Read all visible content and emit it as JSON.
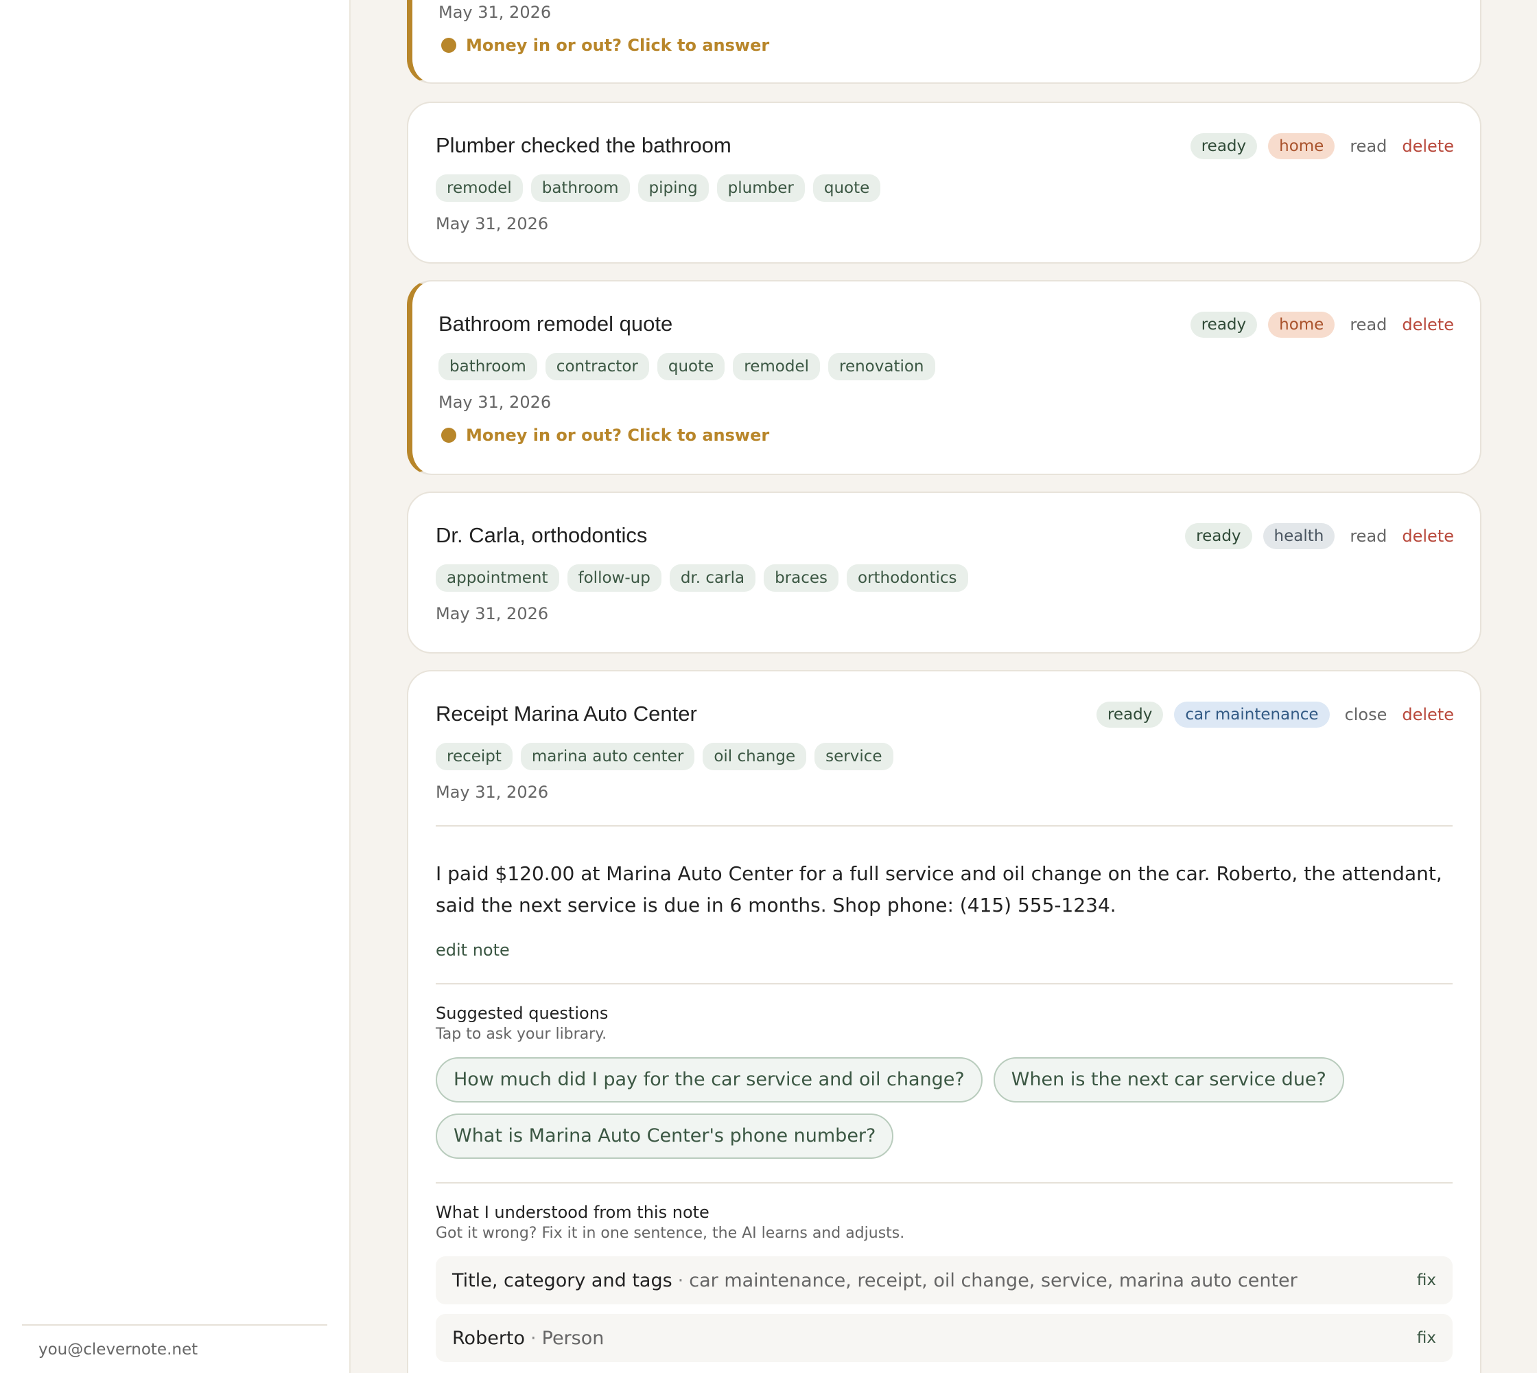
{
  "sidebar": {
    "user_email": "you@clevernote.net"
  },
  "cards": [
    {
      "date": "May 31, 2026",
      "prompt": "Money in or out? Click to answer"
    },
    {
      "title": "Plumber checked the bathroom",
      "status": "ready",
      "category": "home",
      "action": "read",
      "delete": "delete",
      "tags": [
        "remodel",
        "bathroom",
        "piping",
        "plumber",
        "quote"
      ],
      "date": "May 31, 2026"
    },
    {
      "title": "Bathroom remodel quote",
      "status": "ready",
      "category": "home",
      "action": "read",
      "delete": "delete",
      "tags": [
        "bathroom",
        "contractor",
        "quote",
        "remodel",
        "renovation"
      ],
      "date": "May 31, 2026",
      "prompt": "Money in or out? Click to answer"
    },
    {
      "title": "Dr. Carla, orthodontics",
      "status": "ready",
      "category": "health",
      "action": "read",
      "delete": "delete",
      "tags": [
        "appointment",
        "follow-up",
        "dr. carla",
        "braces",
        "orthodontics"
      ],
      "date": "May 31, 2026"
    },
    {
      "title": "Receipt Marina Auto Center",
      "status": "ready",
      "category": "car maintenance",
      "action": "close",
      "delete": "delete",
      "tags": [
        "receipt",
        "marina auto center",
        "oil change",
        "service"
      ],
      "date": "May 31, 2026",
      "body": "I paid $120.00 at Marina Auto Center for a full service and oil change on the car. Roberto, the attendant, said the next service is due in 6 months. Shop phone: (415) 555-1234.",
      "edit_label": "edit note",
      "suggested": {
        "title": "Suggested questions",
        "subtitle": "Tap to ask your library.",
        "questions": [
          "How much did I pay for the car service and oil change?",
          "When is the next car service due?",
          "What is Marina Auto Center's phone number?"
        ]
      },
      "understood": {
        "title": "What I understood from this note",
        "subtitle": "Got it wrong? Fix it in one sentence, the AI learns and adjusts.",
        "separator": "·",
        "rows": [
          {
            "label": "Title, category and tags",
            "value": "car maintenance, receipt, oil change, service, marina auto center",
            "fix": "fix"
          },
          {
            "label": "Roberto",
            "value": "Person",
            "fix": "fix"
          }
        ]
      }
    }
  ]
}
